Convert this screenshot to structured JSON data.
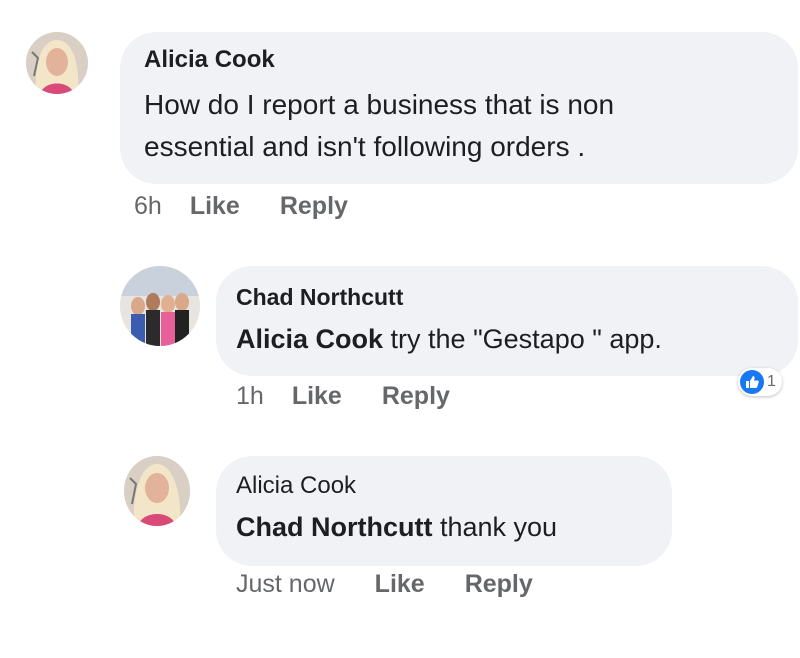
{
  "comments": [
    {
      "author": "Alicia Cook",
      "text_lines": [
        "How do I report a business that is non",
        "essential and isn't following orders ."
      ],
      "time": "6h",
      "like_label": "Like",
      "reply_label": "Reply"
    },
    {
      "author": "Chad Northcutt",
      "mention": "Alicia Cook",
      "text": " try the \"Gestapo \" app.",
      "time": "1h",
      "like_label": "Like",
      "reply_label": "Reply",
      "reaction": {
        "icon": "like-reaction-icon",
        "count": "1",
        "color": "#1877f2"
      }
    },
    {
      "author": "Alicia Cook",
      "mention": "Chad Northcutt",
      "text": " thank you",
      "time": "Just now",
      "like_label": "Like",
      "reply_label": "Reply"
    }
  ],
  "colors": {
    "bubble": "#f0f2f5",
    "meta_text": "#65676b",
    "like_blue": "#1877f2"
  }
}
